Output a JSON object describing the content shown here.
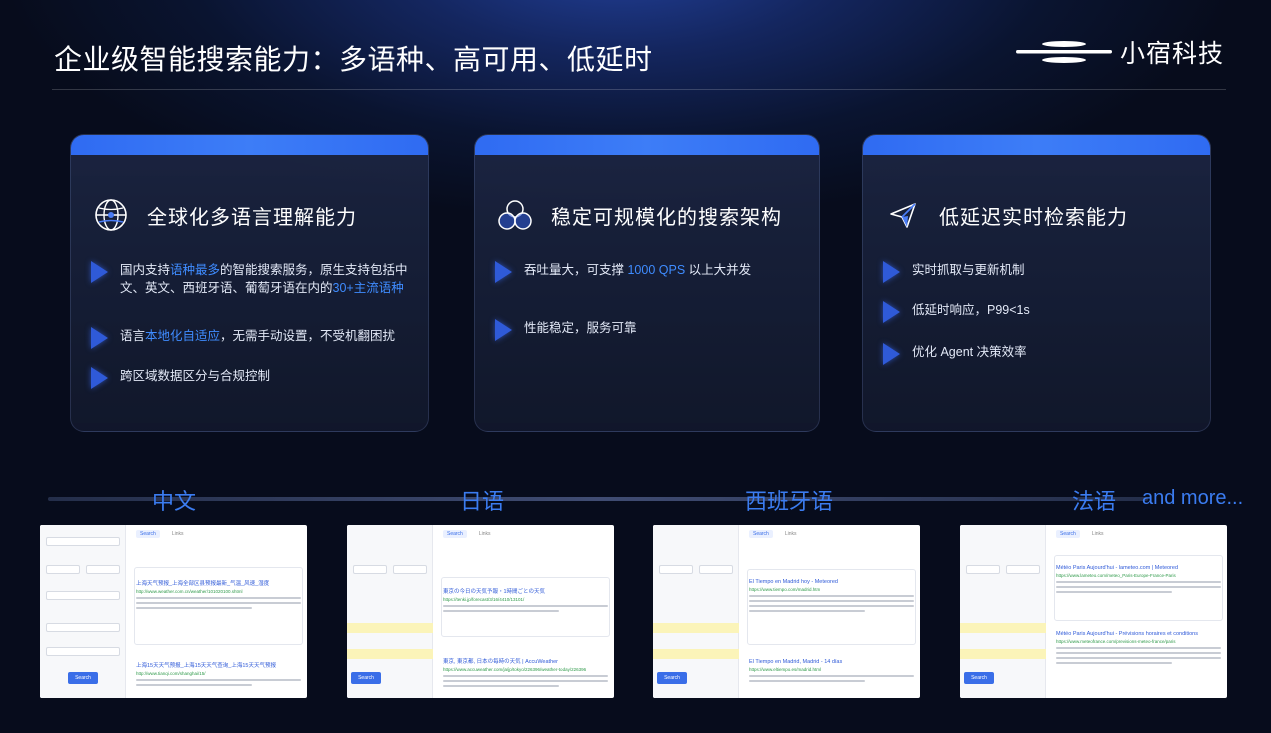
{
  "header": {
    "title": "企业级智能搜索能力：多语种、高可用、低延时",
    "logo_text": "小宿科技"
  },
  "cards": [
    {
      "icon": "globe-icon",
      "title": "全球化多语言理解能力",
      "bullets": [
        {
          "pre": "国内支持",
          "hl": "语种最多",
          "post": "的智能搜索服务，原生支持包括中文、英文、西班牙语、葡萄牙语在内的",
          "hl2": "30+主流语种"
        },
        {
          "pre": "语言",
          "hl": "本地化自适应",
          "post": "，无需手动设置，不受机翻困扰"
        },
        {
          "pre": "跨区域数据区分与合规控制"
        }
      ]
    },
    {
      "icon": "architecture-circles-icon",
      "title": "稳定可规模化的搜索架构",
      "bullets": [
        {
          "pre": "吞吐量大，可支撑 ",
          "hl": "1000 QPS",
          "post": " 以上大并发"
        },
        {
          "pre": "性能稳定，服务可靠"
        }
      ]
    },
    {
      "icon": "paper-plane-icon",
      "title": "低延迟实时检索能力",
      "bullets": [
        {
          "pre": "实时抓取与更新机制"
        },
        {
          "pre": "低延时响应，P99<1s"
        },
        {
          "pre": "优化 Agent 决策效率"
        }
      ]
    }
  ],
  "languages": [
    "中文",
    "日语",
    "西班牙语",
    "法语"
  ],
  "more_label": "and more...",
  "screenshots": [
    {
      "button": "Search",
      "tabs": [
        "Search",
        "Links"
      ],
      "results": [
        {
          "title": "上海天气预报_上海全部区县预报最新_气温_风速_湿度",
          "url": "http://www.weather.com.cn/weather/101020100.shtml"
        },
        {
          "title": "上海15天天气预报_上海15天天气查询_上海15天天气预报",
          "url": "http://www.tianqi.com/shanghai/15/"
        }
      ]
    },
    {
      "button": "Search",
      "tabs": [
        "Search",
        "Links"
      ],
      "results": [
        {
          "title": "東京の今日の天気予報・1時間ごとの天気",
          "url": "https://tenki.jp/forecast/3/16/4410/13101/"
        },
        {
          "title": "東京, 東京都, 日本の毎時の天気 | AccuWeather",
          "url": "https://www.accuweather.com/ja/jp/tokyo/226396/weather-today/226396"
        }
      ]
    },
    {
      "button": "Search",
      "tabs": [
        "Search",
        "Links"
      ],
      "results": [
        {
          "title": "El Tiempo en Madrid hoy - Meteored",
          "url": "https://www.tiempo.com/madrid.htm"
        },
        {
          "title": "El Tiempo en Madrid, Madrid - 14 días",
          "url": "https://www.eltiempo.es/madrid.html"
        }
      ]
    },
    {
      "button": "Search",
      "tabs": [
        "Search",
        "Links"
      ],
      "results": [
        {
          "title": "Météo Paris Aujourd'hui - lameteo.com | Meteored",
          "url": "https://www.lameteo.com/meteo_Paris-Europe-France-Paris"
        },
        {
          "title": "Météo Paris Aujourd'hui - Prévisions horaires et conditions",
          "url": "https://www.meteofrance.com/previsions-meteo-france/paris"
        }
      ]
    }
  ]
}
